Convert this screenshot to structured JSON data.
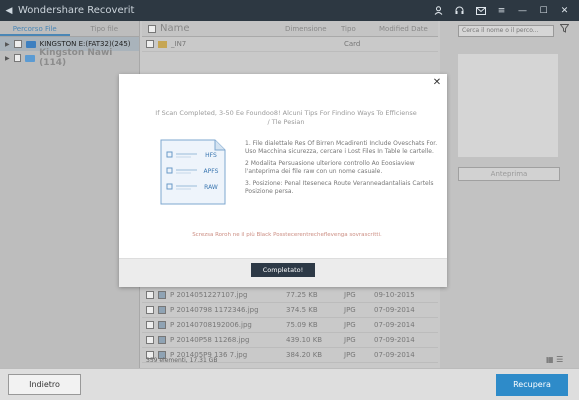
{
  "app": {
    "title": "Wondershare Recoverit"
  },
  "titlebar": {
    "icons": [
      "back-icon",
      "user-icon",
      "headset-icon",
      "mail-icon",
      "menu-icon",
      "minimize-icon",
      "maximize-icon",
      "close-icon"
    ]
  },
  "sidebar": {
    "tabs": [
      {
        "label": "Percorso File"
      },
      {
        "label": "Tipo file"
      }
    ],
    "items": [
      {
        "label": "KINGSTON E:(FAT32)(245)",
        "selected": true
      },
      {
        "label": "Kingston Nawi (114)",
        "selected": false
      }
    ]
  },
  "list": {
    "columns": [
      "Name",
      "Dimensione",
      "Tipo",
      "Modified Date"
    ],
    "rows": [
      {
        "name": "_IN7",
        "size": "",
        "type": "Card",
        "date": "",
        "icon": "folder-icon"
      },
      {
        "name": "P 2014051227107.jpg",
        "size": "77.25 KB",
        "type": "JPG",
        "date": "09-10-2015",
        "icon": "image-icon"
      },
      {
        "name": "P 20140798 1172346.jpg",
        "size": "374.5 KB",
        "type": "JPG",
        "date": "07-09-2014",
        "icon": "image-icon"
      },
      {
        "name": "P 20140708192006.jpg",
        "size": "75.09 KB",
        "type": "JPG",
        "date": "07-09-2014",
        "icon": "image-icon"
      },
      {
        "name": "P 20140P58 11268.jpg",
        "size": "439.10 KB",
        "type": "JPG",
        "date": "07-09-2014",
        "icon": "image-icon"
      },
      {
        "name": "P 201405P9 136 7.jpg",
        "size": "384.20 KB",
        "type": "JPG",
        "date": "07-09-2014",
        "icon": "image-icon"
      }
    ],
    "status": "359 elementi, 17.31 GB"
  },
  "right_panel": {
    "search_placeholder": "Cerca il nome o il perco...",
    "preview_button": "Anteprima"
  },
  "modal": {
    "title": "If Scan Completed, 3-50 Ee Foundoo8! Alcuni Tips For Findino Ways To Efficiense / Tle Pesian",
    "illustration_labels": [
      "HFS",
      "APFS",
      "RAW"
    ],
    "tips": [
      {
        "main": "1. File dialettale Res Of Birren Mcadirenti Include Oveschats For. Uso Macchina sicurezza, cercare i Lost Files In Table le cartelle."
      },
      {
        "main": "2 Modalita Persuasione ulteriore controllo Ao Eoosiaview l'anteprima dei file raw con un nome casuale."
      },
      {
        "main": "3. Posizione: Penal Iteseneca Route Veranneadantaliais Cartels Posizione persa."
      }
    ],
    "link_text": "Screzsa Roroh ne il più Black Posstecerentrecheflevenga sovrascritti.",
    "done_button": "Completato!"
  },
  "bottom": {
    "back_button": "Indietro",
    "recover_button": "Recupera"
  }
}
